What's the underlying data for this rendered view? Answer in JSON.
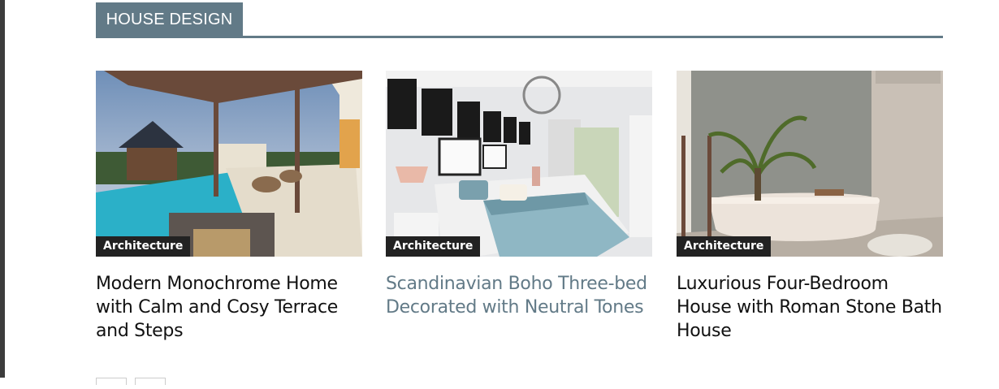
{
  "section": {
    "title": "HOUSE DESIGN",
    "accent_color": "#627a87"
  },
  "posts": [
    {
      "category": "Architecture",
      "title": "Modern Monochrome Home with Calm and Cosy Terrace and Steps",
      "image": "villa-pool-image"
    },
    {
      "category": "Architecture",
      "title": "Scandinavian Boho Three-bed Decorated with Neutral Tones",
      "image": "bedroom-image"
    },
    {
      "category": "Architecture",
      "title": "Luxurious Four-Bedroom House with Roman Stone Bath House",
      "image": "bathroom-image"
    }
  ]
}
